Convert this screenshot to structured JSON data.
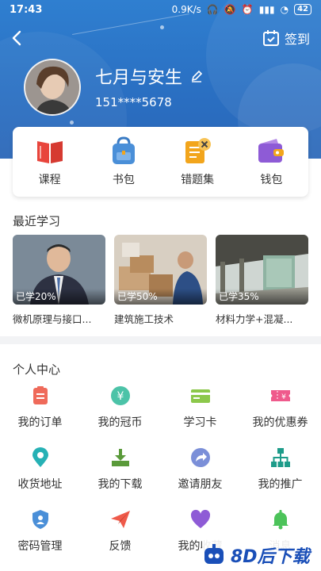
{
  "status_bar": {
    "time": "17:43",
    "speed": "0.9K/s",
    "battery": "42"
  },
  "header": {
    "signin_label": "签到",
    "username": "七月与安生",
    "phone": "151****5678"
  },
  "quick_menu": [
    {
      "label": "课程",
      "icon": "book-icon",
      "color": "#e8453c"
    },
    {
      "label": "书包",
      "icon": "schoolbag-icon",
      "color": "#4a8fd8"
    },
    {
      "label": "错题集",
      "icon": "error-book-icon",
      "color": "#f2a51c"
    },
    {
      "label": "钱包",
      "icon": "wallet-icon",
      "color": "#8e5bd6"
    }
  ],
  "recent": {
    "title": "最近学习",
    "items": [
      {
        "progress": "已学20%",
        "title": "微机原理与接口..."
      },
      {
        "progress": "已学50%",
        "title": "建筑施工技术"
      },
      {
        "progress": "已学35%",
        "title": "材料力学+混凝..."
      }
    ]
  },
  "personal_center": {
    "title": "个人中心",
    "items": [
      {
        "label": "我的订单",
        "icon": "order-icon",
        "color": "#ef6a5a"
      },
      {
        "label": "我的冠币",
        "icon": "coin-icon",
        "color": "#4cc3a8"
      },
      {
        "label": "学习卡",
        "icon": "card-icon",
        "color": "#8cc84b"
      },
      {
        "label": "我的优惠券",
        "icon": "coupon-icon",
        "color": "#ef5a8c"
      },
      {
        "label": "收货地址",
        "icon": "location-icon",
        "color": "#26b1b5"
      },
      {
        "label": "我的下载",
        "icon": "download-icon",
        "color": "#5a9a3a"
      },
      {
        "label": "邀请朋友",
        "icon": "share-icon",
        "color": "#7b8fd8"
      },
      {
        "label": "我的推广",
        "icon": "promotion-icon",
        "color": "#1e9c8a"
      },
      {
        "label": "密码管理",
        "icon": "shield-icon",
        "color": "#4a8fd8"
      },
      {
        "label": "反馈",
        "icon": "paper-plane-icon",
        "color": "#ef5a4a"
      },
      {
        "label": "我的收藏",
        "icon": "heart-icon",
        "color": "#8e5bd6"
      },
      {
        "label": "消息",
        "icon": "bell-icon",
        "color": "#4cc35a"
      }
    ]
  },
  "watermark": {
    "text": "8D后下载"
  }
}
